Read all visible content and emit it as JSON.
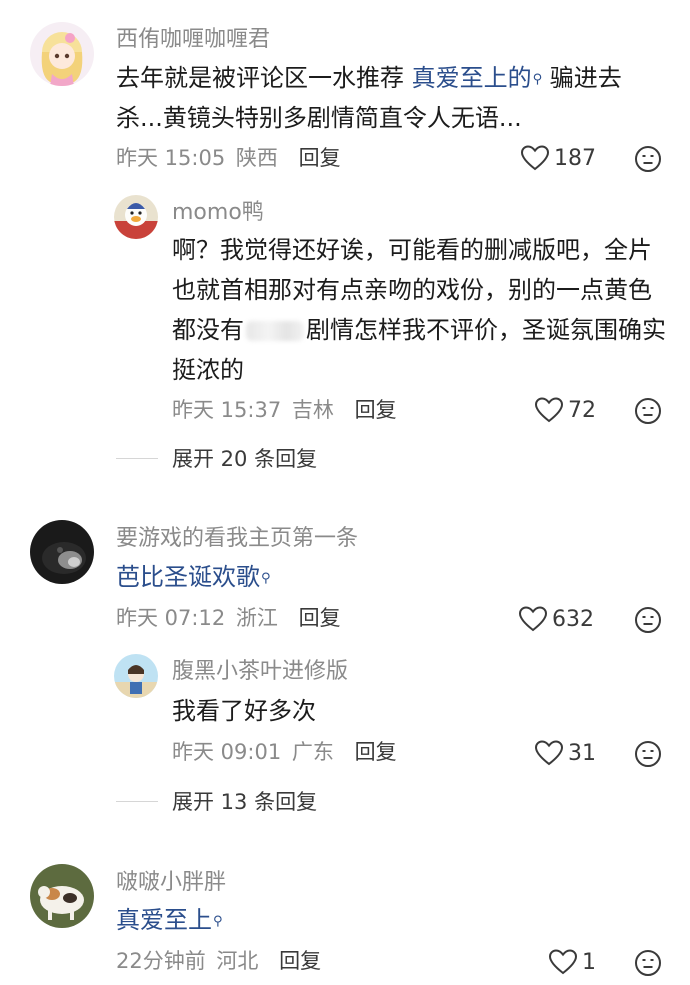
{
  "comments": [
    {
      "username": "西侑咖喱咖喱君",
      "text_lines": [
        {
          "before": "去年就是被评论区一水推荐 ",
          "link": "真爱至上的",
          "after": " 骗进去"
        },
        {
          "plain": "杀...黄镜头特别多剧情简直令人无语..."
        }
      ],
      "time": "昨天 15:05",
      "location": "陕西",
      "reply_label": "回复",
      "likes": "187"
    },
    {
      "username": "momo鸭",
      "text_lines": [
        {
          "plain": "啊？我觉得还好诶，可能看的删减版吧，全片"
        },
        {
          "plain": "也就首相那对有点亲吻的戏份，别的一点黄色"
        },
        {
          "before": "都没有",
          "after": "剧情怎样我不评价，圣诞氛围确实"
        },
        {
          "plain": "挺浓的"
        }
      ],
      "time": "昨天 15:37",
      "location": "吉林",
      "reply_label": "回复",
      "likes": "72",
      "expand_label": "展开 20 条回复"
    },
    {
      "username": "要游戏的看我主页第一条",
      "link": "芭比圣诞欢歌",
      "time": "昨天 07:12",
      "location": "浙江",
      "reply_label": "回复",
      "likes": "632"
    },
    {
      "username": "腹黑小茶叶进修版",
      "text": "我看了好多次",
      "time": "昨天 09:01",
      "location": "广东",
      "reply_label": "回复",
      "likes": "31",
      "expand_label": "展开 13 条回复"
    },
    {
      "username": "啵啵小胖胖",
      "link": "真爱至上",
      "time": "22分钟前",
      "location": "河北",
      "reply_label": "回复",
      "likes": "1"
    }
  ],
  "icons": {
    "search_superscript": "search-icon",
    "like": "heart-outline-icon",
    "dislike": "dislike-face-icon"
  },
  "colors": {
    "link": "#2b4e8c",
    "meta": "#8a8a8a",
    "text": "#1c1c1c"
  }
}
